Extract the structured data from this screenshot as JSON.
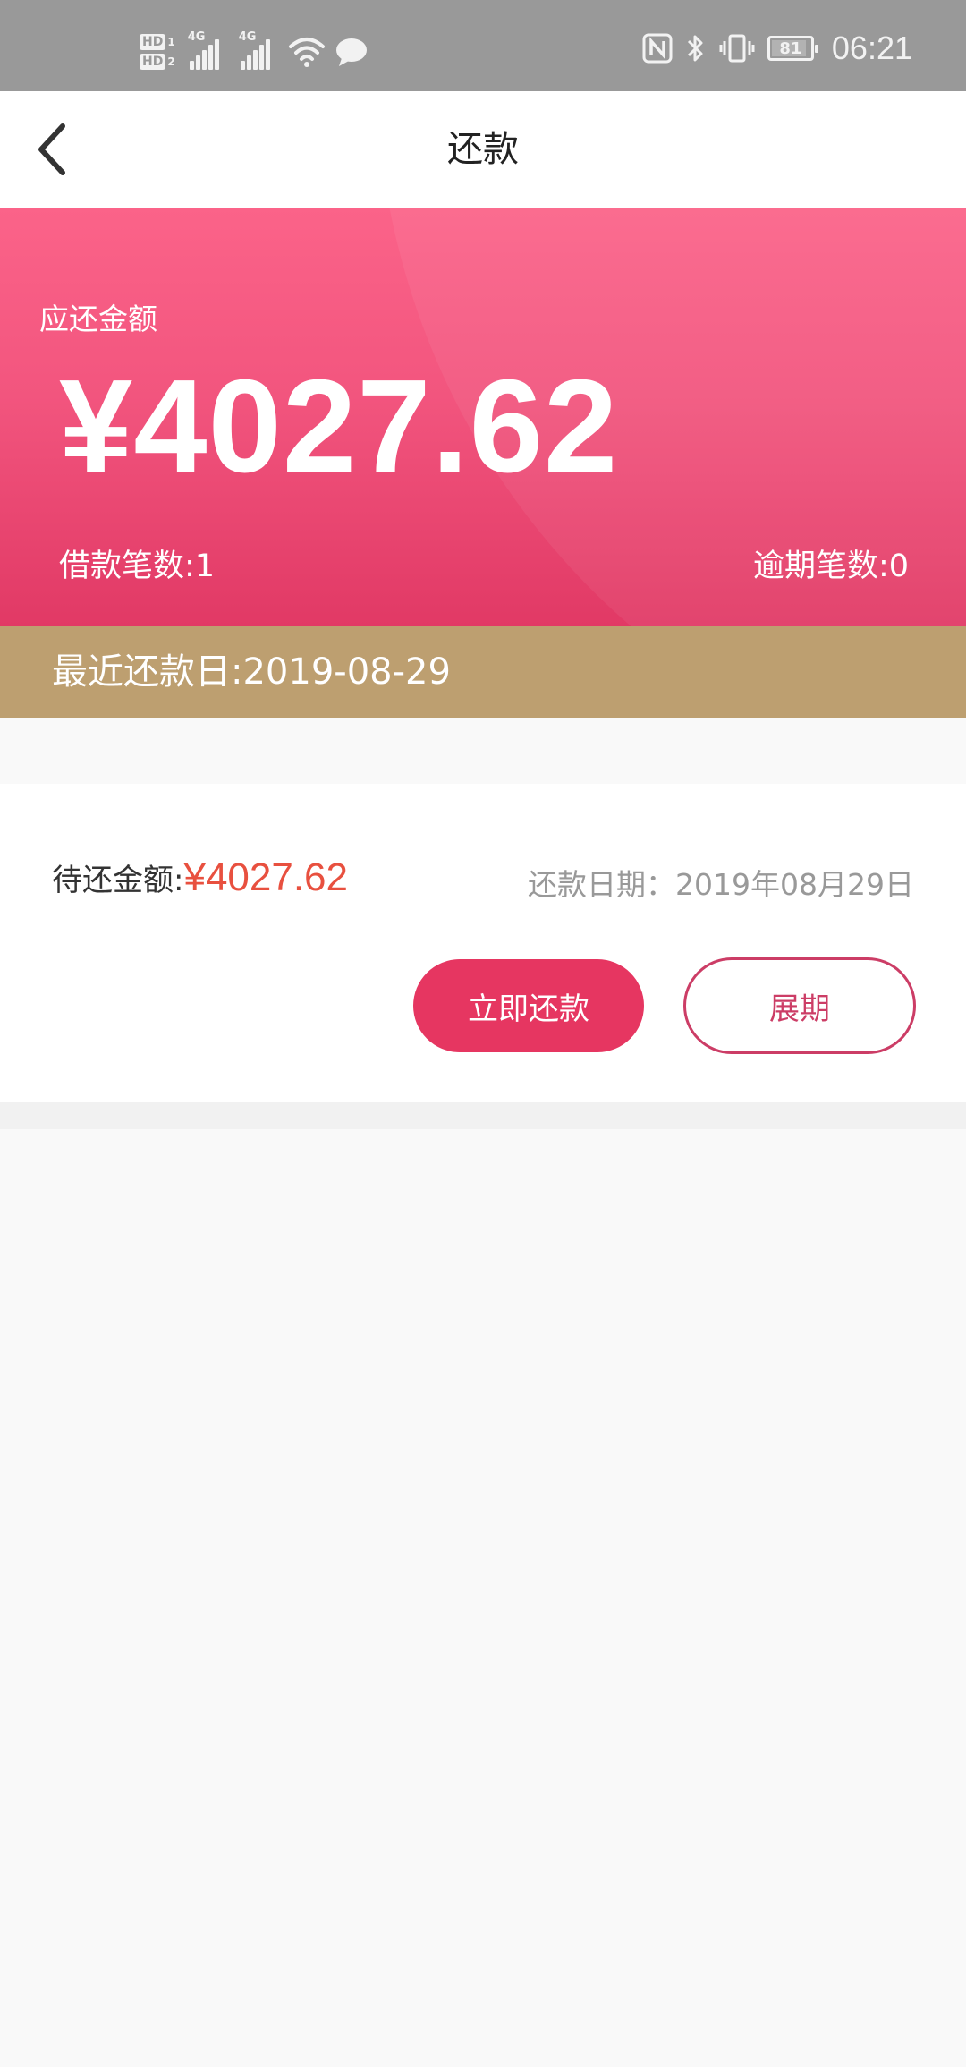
{
  "status_bar": {
    "hd1": "HD",
    "hd1_num": "1",
    "hd2": "HD",
    "hd2_num": "2",
    "net1": "4G",
    "net2": "4G",
    "battery": "81",
    "time": "06:21",
    "icons": [
      "signal-icon",
      "signal-icon",
      "wifi-icon",
      "message-icon",
      "nfc-icon",
      "bluetooth-icon",
      "vibrate-icon",
      "battery-icon"
    ]
  },
  "nav": {
    "title": "还款",
    "back_icon": "chevron-left-icon"
  },
  "banner": {
    "label": "应还金额",
    "amount": "¥4027.62",
    "loan_count": "借款笔数:1",
    "overdue_count": "逾期笔数:0",
    "recent_due": "最近还款日:2019-08-29"
  },
  "card": {
    "due_label": "待还金额:",
    "due_amount": "¥4027.62",
    "due_date": "还款日期：2019年08月29日",
    "pay_button": "立即还款",
    "extend_button": "展期"
  },
  "colors": {
    "banner_top": "#fb6389",
    "banner_bottom": "#e13965",
    "strip": "#bd9f70",
    "amount_red": "#e8503f",
    "primary_button": "#e63661",
    "outline_button": "#cc3d66",
    "status_bar": "#999999"
  }
}
